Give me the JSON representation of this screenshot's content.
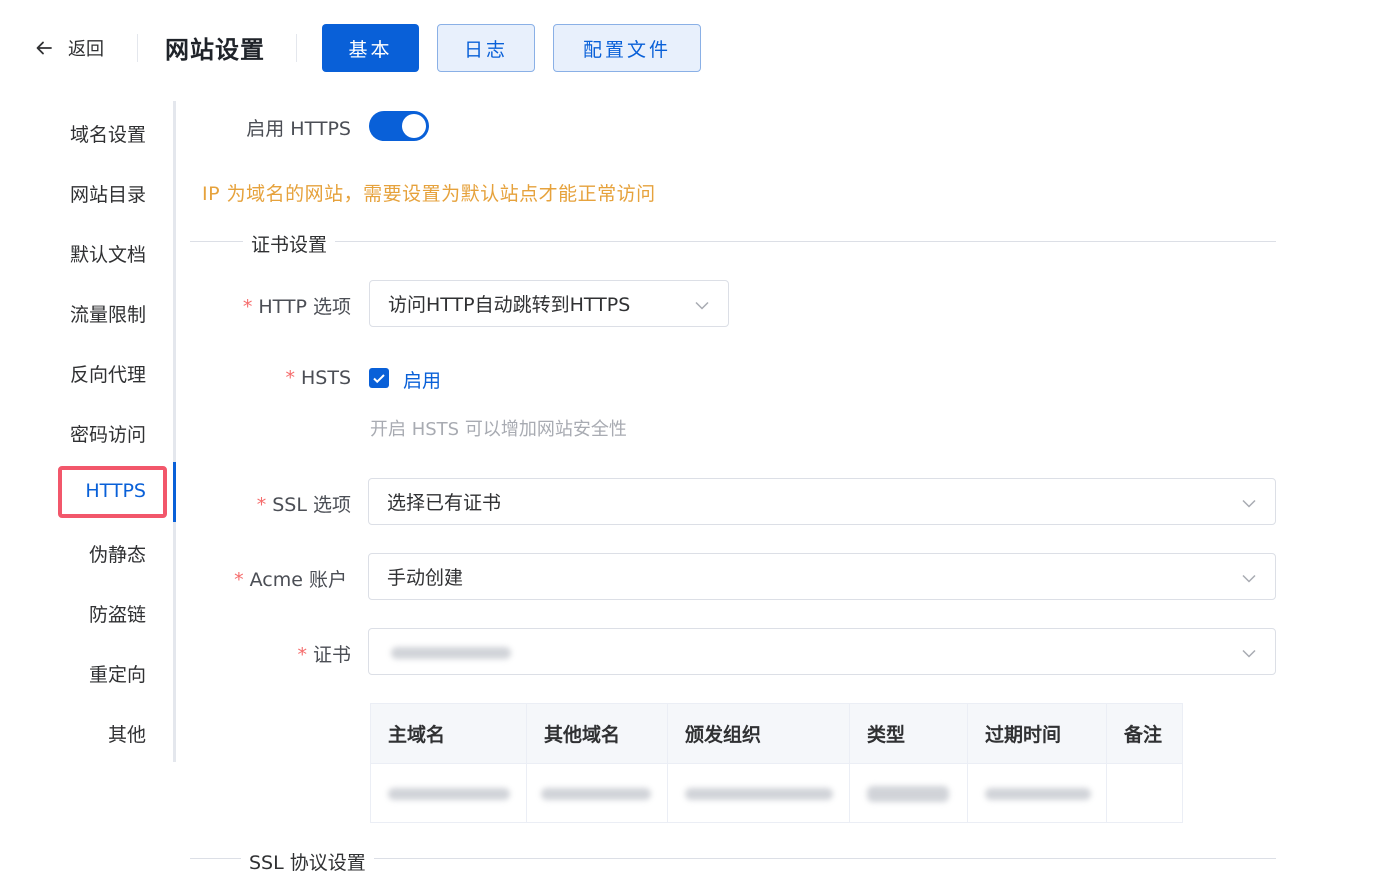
{
  "header": {
    "back_label": "返回",
    "title": "网站设置",
    "tabs": [
      "基本",
      "日志",
      "配置文件"
    ]
  },
  "sidebar": {
    "items": [
      "域名设置",
      "网站目录",
      "默认文档",
      "流量限制",
      "反向代理",
      "密码访问",
      "HTTPS",
      "伪静态",
      "防盗链",
      "重定向",
      "其他"
    ],
    "active": "HTTPS"
  },
  "form": {
    "enable_https_label": "启用 HTTPS",
    "enable_https_on": true,
    "warning": "IP 为域名的网站，需要设置为默认站点才能正常访问",
    "cert_section_title": "证书设置",
    "http_option_label": "HTTP 选项",
    "http_option_value": "访问HTTP自动跳转到HTTPS",
    "hsts_label": "HSTS",
    "hsts_checkbox_label": "启用",
    "hsts_checked": true,
    "hsts_hint": "开启 HSTS 可以增加网站安全性",
    "ssl_option_label": "SSL 选项",
    "ssl_option_value": "选择已有证书",
    "acme_label": "Acme 账户",
    "acme_value": "手动创建",
    "cert_label": "证书",
    "required_mark": "*",
    "ssl_protocol_section_title": "SSL 协议设置"
  },
  "cert_table": {
    "columns": [
      "主域名",
      "其他域名",
      "颁发组织",
      "类型",
      "过期时间",
      "备注"
    ]
  },
  "colors": {
    "primary": "#0960d8",
    "warning": "#e6a23c",
    "highlight_box": "#f2576b"
  }
}
